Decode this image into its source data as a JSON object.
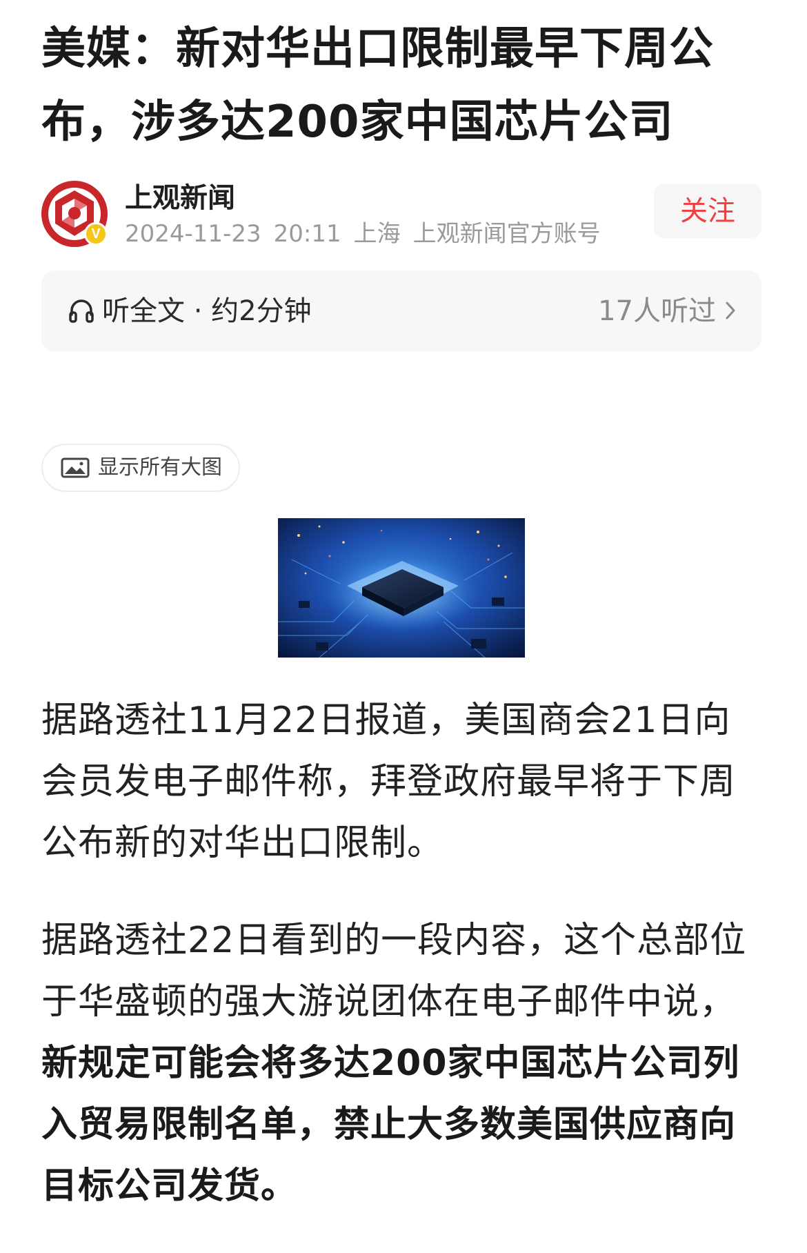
{
  "article": {
    "title": "美媒：新对华出口限制最早下周公布，涉多达200家中国芯片公司",
    "author": {
      "name": "上观新闻",
      "date": "2024-11-23",
      "time": "20:11",
      "location": "上海",
      "account_type": "上观新闻官方账号",
      "verified_badge": "V",
      "follow_label": "关注"
    },
    "listen": {
      "label": "听全文 · 约2分钟",
      "listeners": "17人听过",
      "icon": "headphones-icon"
    },
    "show_all_images": {
      "label": "显示所有大图",
      "icon": "image-icon"
    },
    "paragraphs": [
      {
        "text": "据路透社11月22日报道，美国商会21日向会员发电子邮件称，拜登政府最早将于下周公布新的对华出口限制。"
      },
      {
        "text_plain": "据路透社22日看到的一段内容，这个总部位于华盛顿的强大游说团体在电子邮件中说，",
        "text_bold": "新规定可能会将多达200家中国芯片公司列入贸易限制名单，禁止大多数美国供应商向目标公司发货。"
      }
    ]
  },
  "colors": {
    "follow_text": "#f04142",
    "follow_bg": "#f6f6f6",
    "badge": "#f5c518",
    "avatar_red": "#c8262b",
    "meta_gray": "#9a9a9a"
  }
}
